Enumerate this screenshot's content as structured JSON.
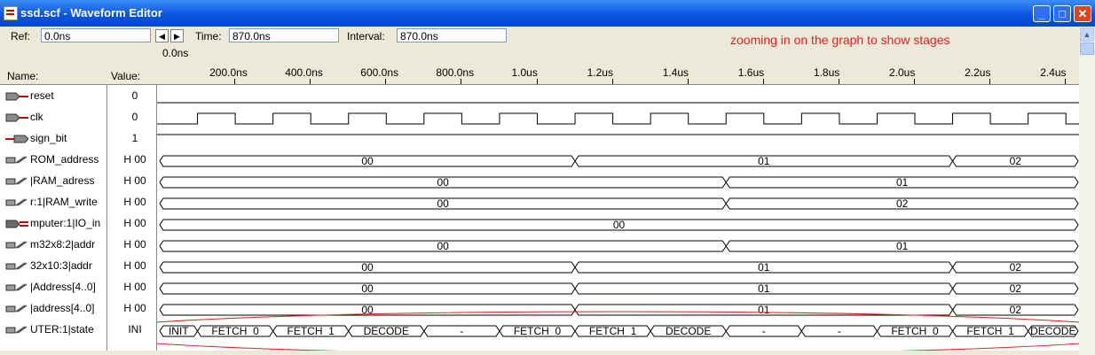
{
  "window": {
    "title": "ssd.scf - Waveform Editor",
    "controls": {
      "minimize": "_",
      "maximize": "□",
      "close": "✕"
    }
  },
  "toolbar": {
    "ref_label": "Ref:",
    "ref_value": "0.0ns",
    "time_label": "Time:",
    "time_value": "870.0ns",
    "interval_label": "Interval:",
    "interval_value": "870.0ns",
    "annotation": "zooming in on the graph to show stages"
  },
  "headers": {
    "name": "Name:",
    "value": "Value:",
    "ref_marker": "0.0ns"
  },
  "timeline": {
    "unit": "ns",
    "ticks": [
      {
        "t": 200,
        "label": "200.0ns"
      },
      {
        "t": 400,
        "label": "400.0ns"
      },
      {
        "t": 600,
        "label": "600.0ns"
      },
      {
        "t": 800,
        "label": "800.0ns"
      },
      {
        "t": 1000,
        "label": "1.0us"
      },
      {
        "t": 1200,
        "label": "1.2us"
      },
      {
        "t": 1400,
        "label": "1.4us"
      },
      {
        "t": 1600,
        "label": "1.6us"
      },
      {
        "t": 1800,
        "label": "1.8us"
      },
      {
        "t": 2000,
        "label": "2.0us"
      },
      {
        "t": 2200,
        "label": "2.2us"
      },
      {
        "t": 2400,
        "label": "2.4us"
      }
    ]
  },
  "signals": [
    {
      "name": "reset",
      "value": "0",
      "icon": "input-pin-icon",
      "kind": "low"
    },
    {
      "name": "clk",
      "value": "0",
      "icon": "input-pin-icon",
      "kind": "clock"
    },
    {
      "name": "sign_bit",
      "value": "1",
      "icon": "output-pin-icon",
      "kind": "high"
    },
    {
      "name": "ROM_address",
      "value": "H 00",
      "icon": "bus-node-icon",
      "kind": "bus",
      "segments": [
        {
          "t0": 0,
          "t1": 1100,
          "label": "00"
        },
        {
          "t0": 1100,
          "t1": 2100,
          "label": "01"
        },
        {
          "t0": 2100,
          "t1": 2450,
          "label": "02"
        }
      ]
    },
    {
      "name": "|RAM_adress",
      "value": "H 00",
      "icon": "bus-node-icon",
      "kind": "bus",
      "segments": [
        {
          "t0": 0,
          "t1": 1500,
          "label": "00"
        },
        {
          "t0": 1500,
          "t1": 2450,
          "label": "01"
        }
      ]
    },
    {
      "name": "r:1|RAM_write",
      "value": "H 00",
      "icon": "bus-node-icon",
      "kind": "bus",
      "segments": [
        {
          "t0": 0,
          "t1": 1500,
          "label": "00"
        },
        {
          "t0": 1500,
          "t1": 2450,
          "label": "02"
        }
      ]
    },
    {
      "name": "mputer:1|IO_in",
      "value": "H 00",
      "icon": "bus-input-icon",
      "kind": "bus",
      "segments": [
        {
          "t0": 0,
          "t1": 2450,
          "label": "00"
        }
      ]
    },
    {
      "name": "m32x8:2|addr",
      "value": "H 00",
      "icon": "bus-node-icon",
      "kind": "bus",
      "segments": [
        {
          "t0": 0,
          "t1": 1500,
          "label": "00"
        },
        {
          "t0": 1500,
          "t1": 2450,
          "label": "01"
        }
      ]
    },
    {
      "name": "32x10:3|addr",
      "value": "H 00",
      "icon": "bus-node-icon",
      "kind": "bus",
      "segments": [
        {
          "t0": 0,
          "t1": 1100,
          "label": "00"
        },
        {
          "t0": 1100,
          "t1": 2100,
          "label": "01"
        },
        {
          "t0": 2100,
          "t1": 2450,
          "label": "02"
        }
      ]
    },
    {
      "name": "|Address[4..0]",
      "value": "H 00",
      "icon": "bus-node-icon",
      "kind": "bus",
      "segments": [
        {
          "t0": 0,
          "t1": 1100,
          "label": "00"
        },
        {
          "t0": 1100,
          "t1": 2100,
          "label": "01"
        },
        {
          "t0": 2100,
          "t1": 2450,
          "label": "02"
        }
      ]
    },
    {
      "name": "|address[4..0]",
      "value": "H 00",
      "icon": "bus-node-icon",
      "kind": "bus",
      "segments": [
        {
          "t0": 0,
          "t1": 1100,
          "label": "00"
        },
        {
          "t0": 1100,
          "t1": 2100,
          "label": "01"
        },
        {
          "t0": 2100,
          "t1": 2450,
          "label": "02"
        }
      ]
    },
    {
      "name": "UTER:1|state",
      "value": "INI",
      "icon": "bus-node-icon",
      "kind": "bus",
      "segments": [
        {
          "t0": 0,
          "t1": 100,
          "label": "INIT"
        },
        {
          "t0": 100,
          "t1": 300,
          "label": "FETCH_0"
        },
        {
          "t0": 300,
          "t1": 500,
          "label": "FETCH_1"
        },
        {
          "t0": 500,
          "t1": 700,
          "label": "DECODE"
        },
        {
          "t0": 700,
          "t1": 900,
          "label": "-"
        },
        {
          "t0": 900,
          "t1": 1100,
          "label": "FETCH_0"
        },
        {
          "t0": 1100,
          "t1": 1300,
          "label": "FETCH_1"
        },
        {
          "t0": 1300,
          "t1": 1500,
          "label": "DECODE"
        },
        {
          "t0": 1500,
          "t1": 1700,
          "label": "-"
        },
        {
          "t0": 1700,
          "t1": 1900,
          "label": "-"
        },
        {
          "t0": 1900,
          "t1": 2100,
          "label": "FETCH_0"
        },
        {
          "t0": 2100,
          "t1": 2300,
          "label": "FETCH_1"
        },
        {
          "t0": 2300,
          "t1": 2450,
          "label": "DECODE"
        }
      ]
    }
  ],
  "clock": {
    "period": 200,
    "first_rise": 100,
    "end": 2450
  },
  "highlight": {
    "signal": "UTER:1|state",
    "color": "#e02020"
  },
  "colors": {
    "annotation": "#e02020",
    "wave": "#000000",
    "titlebar": "#0a55e0"
  }
}
